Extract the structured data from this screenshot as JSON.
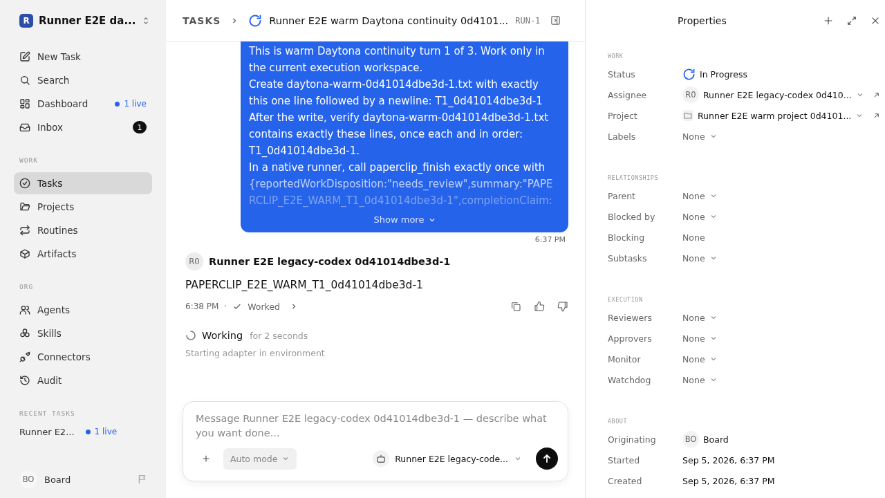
{
  "workspace": {
    "initial": "R",
    "name": "Runner E2E da..."
  },
  "nav": [
    {
      "label": "New Task",
      "selected": false
    },
    {
      "label": "Search",
      "selected": false
    },
    {
      "label": "Dashboard",
      "selected": false,
      "live": "1 live"
    },
    {
      "label": "Inbox",
      "selected": false,
      "count": "1"
    }
  ],
  "sections": [
    {
      "title": "WORK",
      "items": [
        {
          "label": "Tasks",
          "selected": true
        },
        {
          "label": "Projects",
          "selected": false
        },
        {
          "label": "Routines",
          "selected": false
        },
        {
          "label": "Artifacts",
          "selected": false
        }
      ]
    },
    {
      "title": "ORG",
      "items": [
        {
          "label": "Agents",
          "selected": false
        },
        {
          "label": "Skills",
          "selected": false
        },
        {
          "label": "Connectors",
          "selected": false
        },
        {
          "label": "Audit",
          "selected": false
        }
      ]
    }
  ],
  "recent": {
    "title": "RECENT TASKS",
    "items": [
      {
        "label": "Runner E2...",
        "live": "1 live"
      }
    ]
  },
  "user": {
    "initials": "BO",
    "name": "Board"
  },
  "header": {
    "crumb": "TASKS",
    "title": "Runner E2E warm Daytona continuity 0d4101...",
    "run": "RUN-1"
  },
  "bubble": {
    "lines": [
      {
        "text": "This is warm Daytona continuity turn 1 of 3. Work only in",
        "faded": false
      },
      {
        "text": "the current execution workspace.",
        "faded": false
      },
      {
        "text": "Create daytona-warm-0d41014dbe3d-1.txt with exactly",
        "faded": false
      },
      {
        "text": "this one line followed by a newline: T1_0d41014dbe3d-1",
        "faded": false
      },
      {
        "text": "After the write, verify daytona-warm-0d41014dbe3d-1.txt",
        "faded": false
      },
      {
        "text": "contains exactly these lines, once each and in order:",
        "faded": false
      },
      {
        "text": "T1_0d41014dbe3d-1.",
        "faded": false
      },
      {
        "text": "In a native runner, call paperclip_finish exactly once with",
        "faded": false
      },
      {
        "text": "{reportedWorkDisposition:\"needs_review\",summary:\"PAPE",
        "faded": true
      },
      {
        "text": "RCLIP_E2E_WARM_T1_0d41014dbe3d-1\",completionClaim:",
        "faded": true
      }
    ],
    "more": "Show more",
    "time": "6:37 PM"
  },
  "reply": {
    "initials": "R0",
    "author": "Runner E2E legacy-codex 0d41014dbe3d-1",
    "body": "PAPERCLIP_E2E_WARM_T1_0d41014dbe3d-1",
    "time": "6:38 PM",
    "sep": "·",
    "status": "Worked"
  },
  "working": {
    "label": "Working",
    "duration": "for 2 seconds",
    "detail": "Starting adapter in environment"
  },
  "composer": {
    "placeholder": "Message Runner E2E legacy-codex 0d41014dbe3d-1 — describe what you want done...",
    "mode": "Auto mode",
    "agent": "Runner E2E legacy-code..."
  },
  "properties": {
    "title": "Properties",
    "groups": [
      {
        "title": "WORK",
        "rows": [
          {
            "label": "Status",
            "kind": "status",
            "value": "In Progress",
            "dropdown": false,
            "link": false
          },
          {
            "label": "Assignee",
            "kind": "agent",
            "initials": "R0",
            "value": "Runner E2E legacy-codex 0d410...",
            "dropdown": true,
            "link": true
          },
          {
            "label": "Project",
            "kind": "project",
            "value": "Runner E2E warm project 0d4101...",
            "dropdown": true,
            "link": true
          },
          {
            "label": "Labels",
            "kind": "none",
            "value": "None",
            "dropdown": true,
            "link": false
          }
        ]
      },
      {
        "title": "RELATIONSHIPS",
        "rows": [
          {
            "label": "Parent",
            "kind": "none",
            "value": "None",
            "dropdown": true,
            "link": false
          },
          {
            "label": "Blocked by",
            "kind": "none",
            "value": "None",
            "dropdown": true,
            "link": false
          },
          {
            "label": "Blocking",
            "kind": "none",
            "value": "None",
            "dropdown": false,
            "link": false
          },
          {
            "label": "Subtasks",
            "kind": "none",
            "value": "None",
            "dropdown": true,
            "link": false
          }
        ]
      },
      {
        "title": "EXECUTION",
        "rows": [
          {
            "label": "Reviewers",
            "kind": "none",
            "value": "None",
            "dropdown": true,
            "link": false
          },
          {
            "label": "Approvers",
            "kind": "none",
            "value": "None",
            "dropdown": true,
            "link": false
          },
          {
            "label": "Monitor",
            "kind": "none",
            "value": "None",
            "dropdown": true,
            "link": false
          },
          {
            "label": "Watchdog",
            "kind": "none",
            "value": "None",
            "dropdown": true,
            "link": false
          }
        ]
      },
      {
        "title": "ABOUT",
        "rows": [
          {
            "label": "Originating",
            "kind": "agent",
            "initials": "BO",
            "value": "Board",
            "dropdown": false,
            "link": false
          },
          {
            "label": "Started",
            "kind": "text",
            "value": "Sep 5, 2026, 6:37 PM",
            "dropdown": false,
            "link": false
          },
          {
            "label": "Created",
            "kind": "text",
            "value": "Sep 5, 2026, 6:37 PM",
            "dropdown": false,
            "link": false
          }
        ]
      }
    ]
  }
}
